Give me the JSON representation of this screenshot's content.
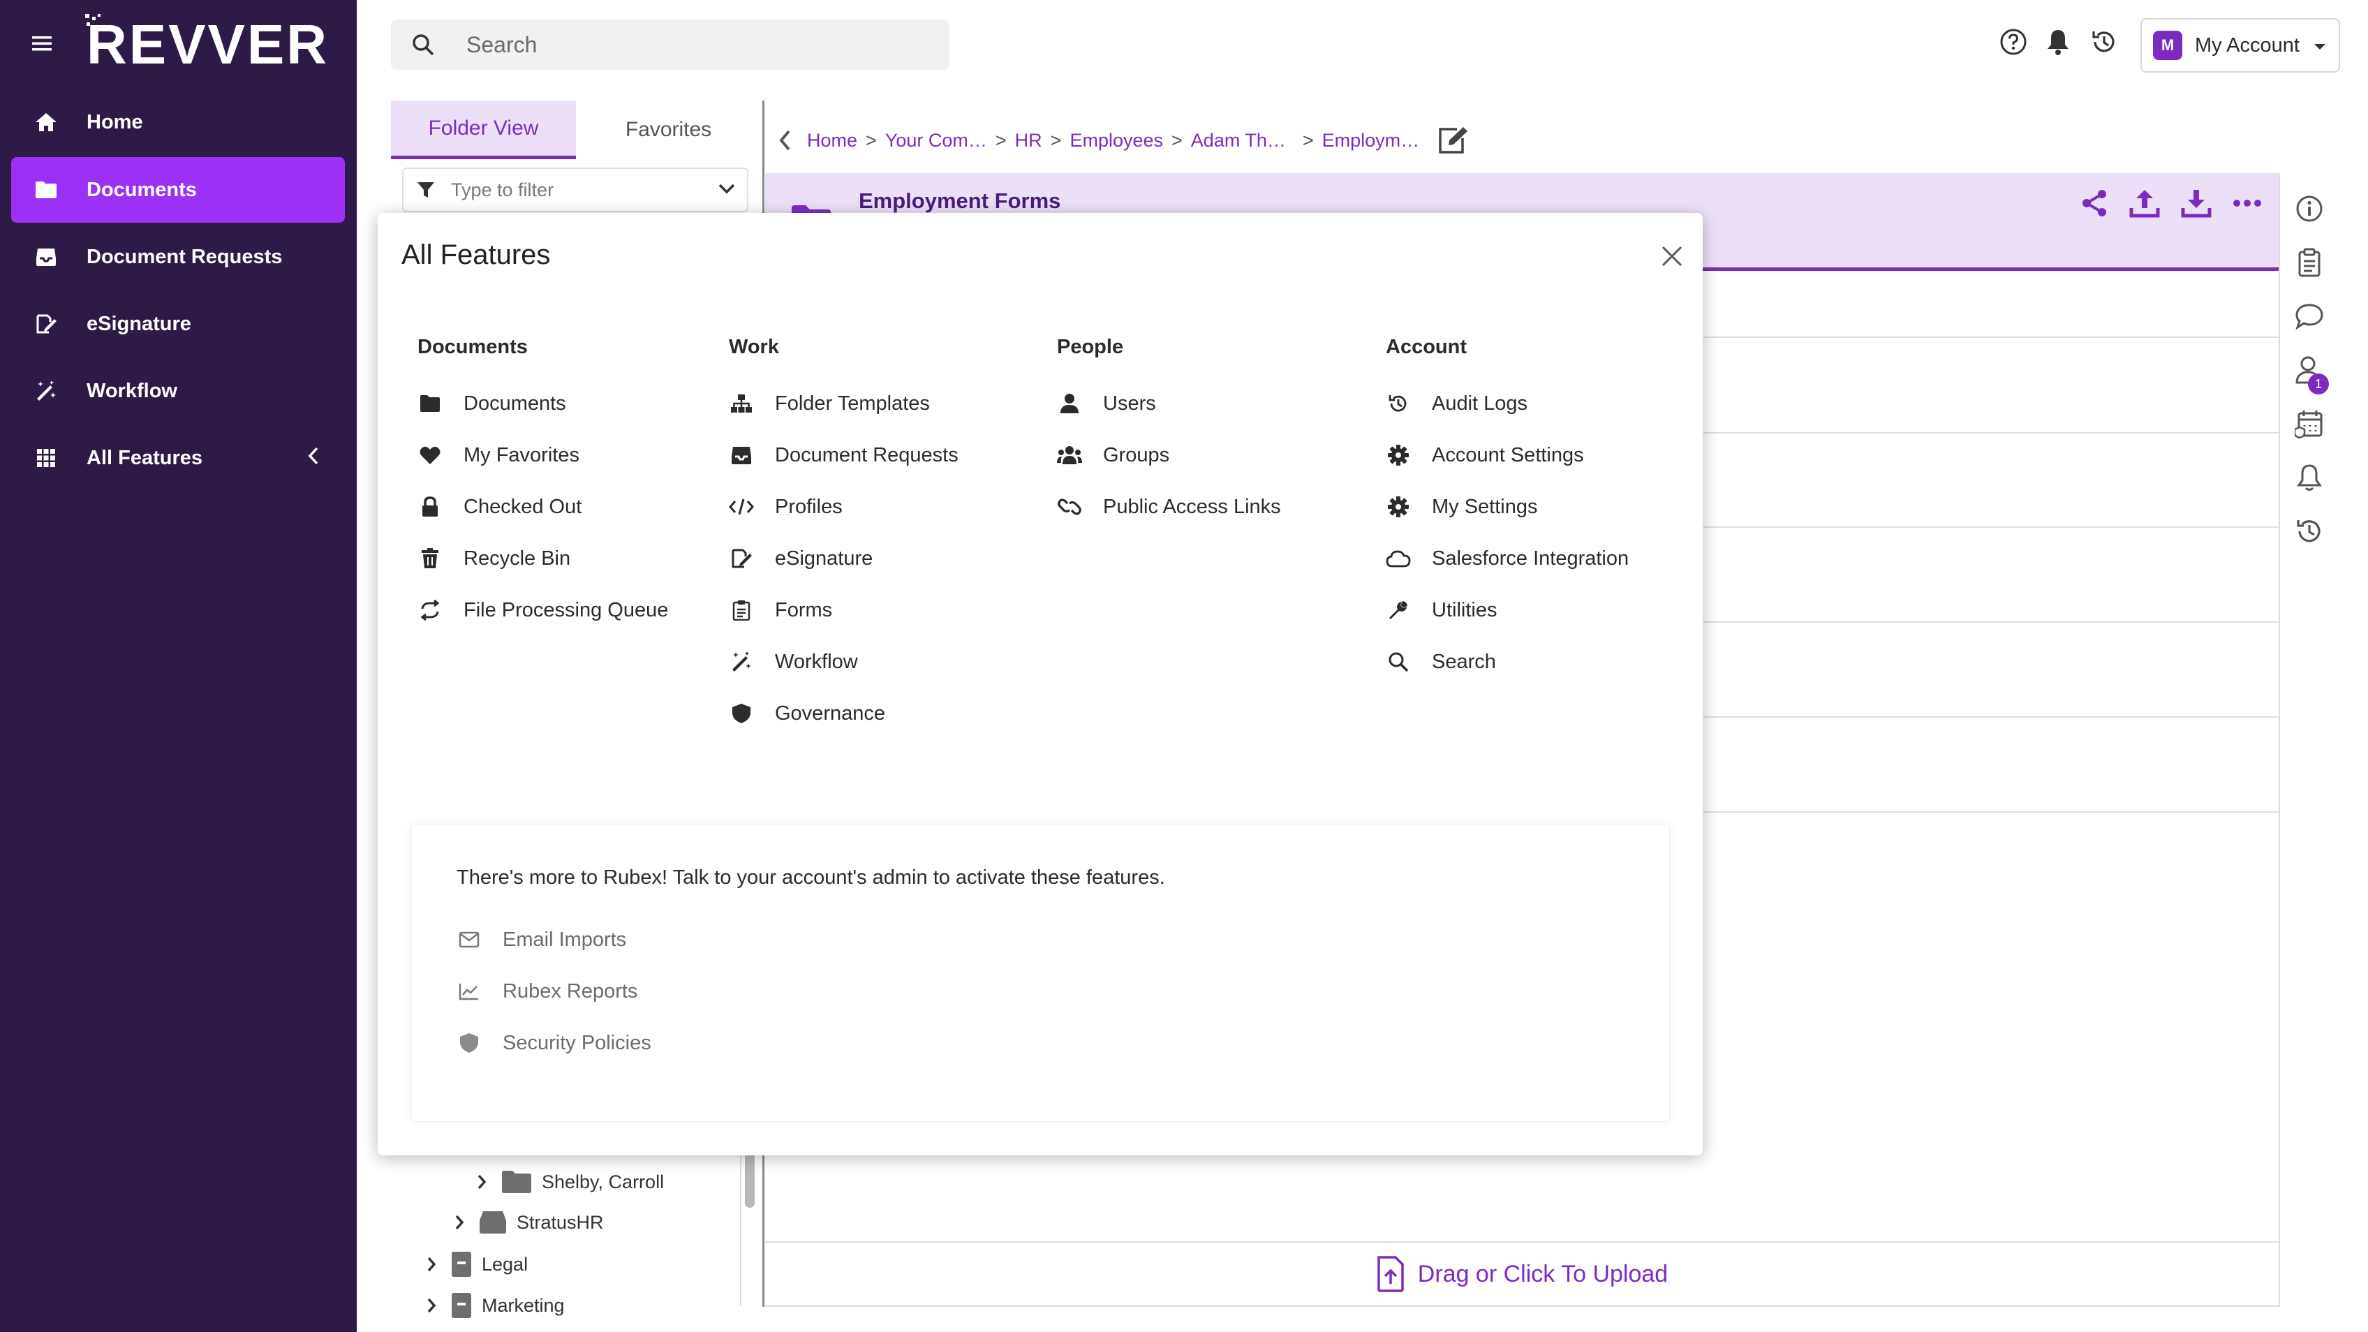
{
  "app": {
    "logo": "REVVER"
  },
  "nav": {
    "items": [
      {
        "label": "Home",
        "icon": "home-icon"
      },
      {
        "label": "Documents",
        "icon": "folder-icon",
        "active": true
      },
      {
        "label": "Document Requests",
        "icon": "inbox-icon"
      },
      {
        "label": "eSignature",
        "icon": "signature-icon"
      },
      {
        "label": "Workflow",
        "icon": "magic-wand-icon"
      },
      {
        "label": "All Features",
        "icon": "grid-icon"
      }
    ]
  },
  "topbar": {
    "search_placeholder": "Search",
    "account_initial": "M",
    "account_label": "My Account"
  },
  "panel": {
    "tabs": [
      "Folder View",
      "Favorites"
    ],
    "filter_placeholder": "Type to filter",
    "tree": [
      {
        "label": "Shelby, Carroll"
      },
      {
        "label": "StratusHR"
      },
      {
        "label": "Legal"
      },
      {
        "label": "Marketing"
      }
    ]
  },
  "breadcrumb": {
    "items": [
      "Home",
      "Your Com…",
      "HR",
      "Employees",
      "Adam Th…",
      "Employm…"
    ],
    "separator": ">"
  },
  "folder": {
    "title": "Employment Forms"
  },
  "upload": {
    "label": "Drag or Click To Upload"
  },
  "rail": {
    "badge_count": "1"
  },
  "modal": {
    "title": "All Features",
    "columns": [
      {
        "heading": "Documents",
        "items": [
          {
            "label": "Documents",
            "icon": "folder-icon"
          },
          {
            "label": "My Favorites",
            "icon": "heart-icon"
          },
          {
            "label": "Checked Out",
            "icon": "lock-icon"
          },
          {
            "label": "Recycle Bin",
            "icon": "trash-icon"
          },
          {
            "label": "File Processing Queue",
            "icon": "sync-icon"
          }
        ]
      },
      {
        "heading": "Work",
        "items": [
          {
            "label": "Folder Templates",
            "icon": "sitemap-icon"
          },
          {
            "label": "Document Requests",
            "icon": "inbox-icon"
          },
          {
            "label": "Profiles",
            "icon": "code-icon"
          },
          {
            "label": "eSignature",
            "icon": "signature-icon"
          },
          {
            "label": "Forms",
            "icon": "clipboard-icon"
          },
          {
            "label": "Workflow",
            "icon": "magic-wand-icon"
          },
          {
            "label": "Governance",
            "icon": "shield-icon"
          }
        ]
      },
      {
        "heading": "People",
        "items": [
          {
            "label": "Users",
            "icon": "user-icon"
          },
          {
            "label": "Groups",
            "icon": "users-icon"
          },
          {
            "label": "Public Access Links",
            "icon": "link-icon"
          }
        ]
      },
      {
        "heading": "Account",
        "items": [
          {
            "label": "Audit Logs",
            "icon": "history-icon"
          },
          {
            "label": "Account Settings",
            "icon": "gear-icon"
          },
          {
            "label": "My Settings",
            "icon": "gear-icon"
          },
          {
            "label": "Salesforce Integration",
            "icon": "cloud-icon"
          },
          {
            "label": "Utilities",
            "icon": "wrench-icon"
          },
          {
            "label": "Search",
            "icon": "search-icon"
          }
        ]
      }
    ],
    "more": {
      "text": "There's more to Rubex! Talk to your account's admin to activate these features.",
      "items": [
        {
          "label": "Email Imports",
          "icon": "envelope-icon"
        },
        {
          "label": "Rubex Reports",
          "icon": "chart-icon"
        },
        {
          "label": "Security Policies",
          "icon": "shield-icon"
        }
      ]
    }
  },
  "colors": {
    "sidebar_bg": "#2e1a47",
    "accent": "#9d30f5",
    "brand_purple": "#7b2cbf",
    "header_tint": "#ece0f8"
  }
}
